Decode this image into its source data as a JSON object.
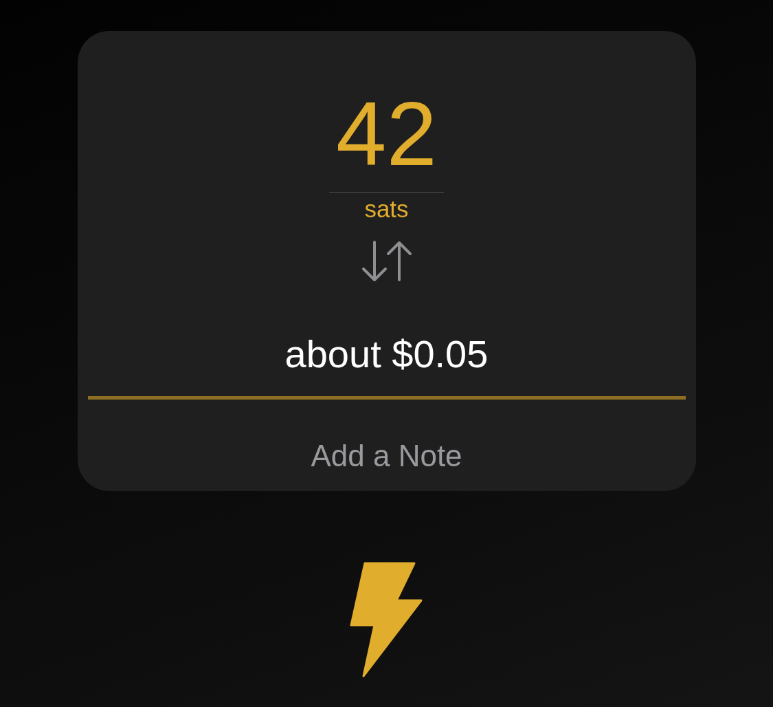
{
  "amount": {
    "value": "42",
    "unit": "sats"
  },
  "fiat": {
    "text": "about $0.05"
  },
  "note": {
    "placeholder": "Add a Note"
  }
}
